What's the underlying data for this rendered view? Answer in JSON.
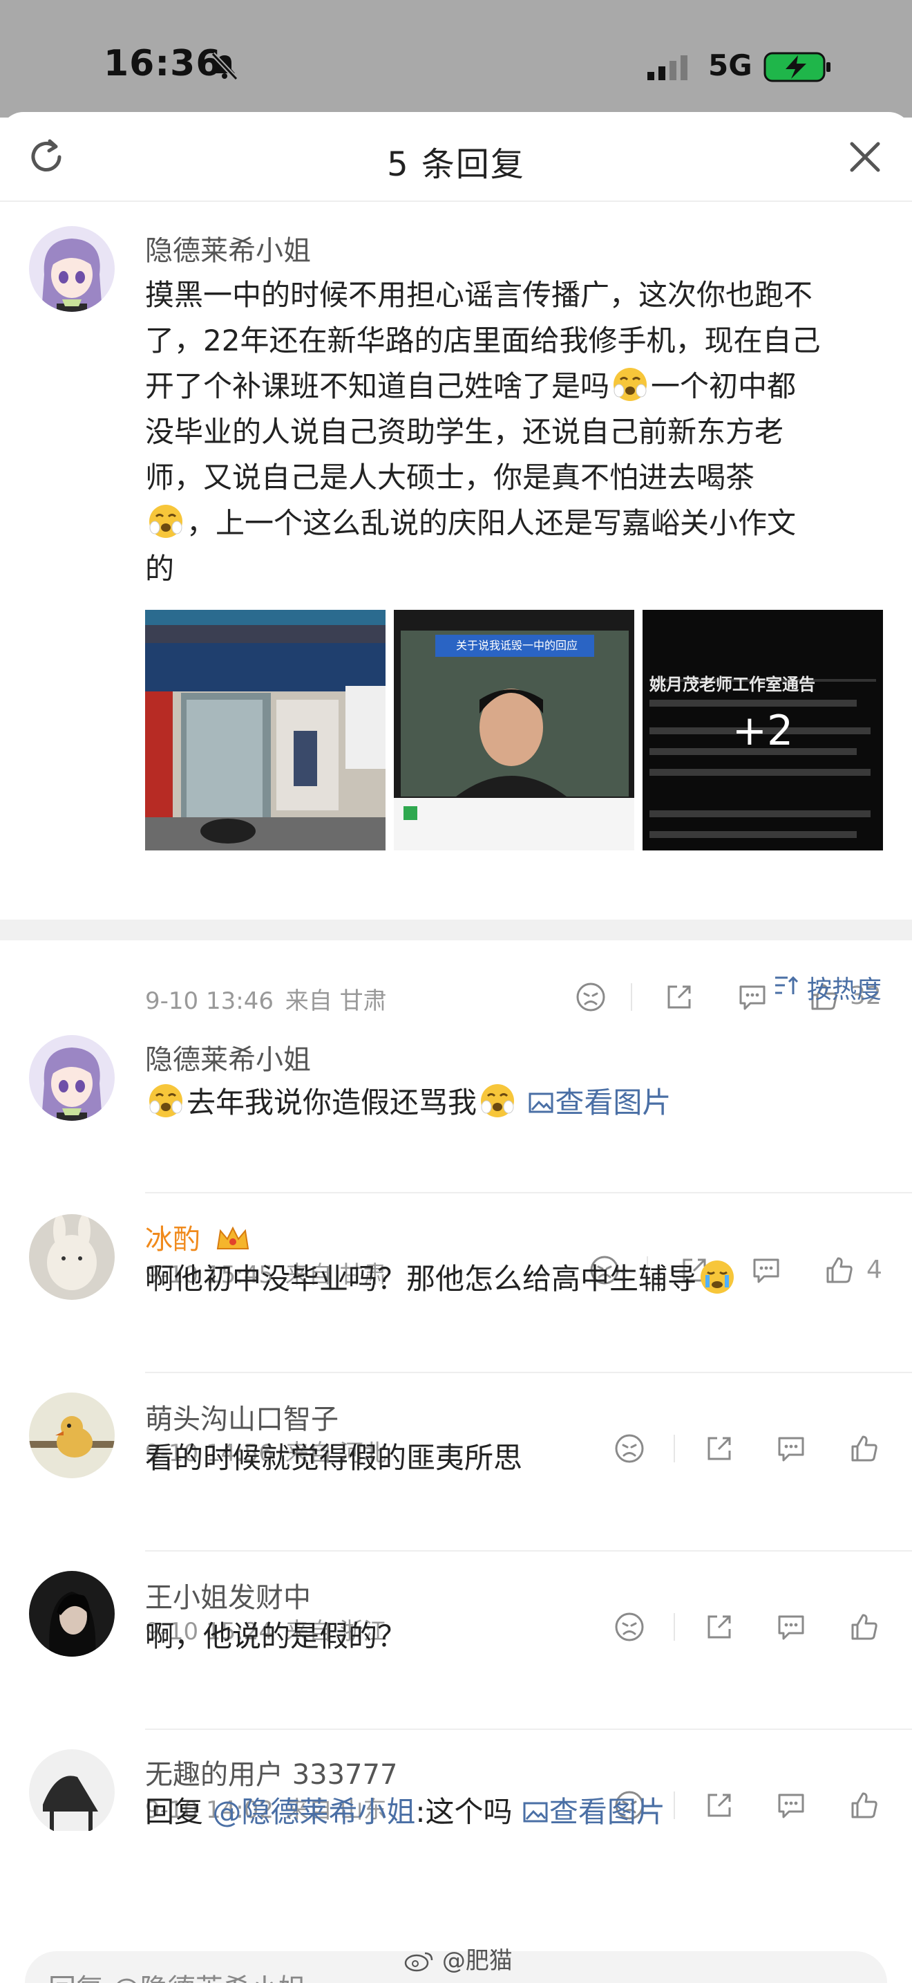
{
  "status": {
    "time": "16:36",
    "network": "5G"
  },
  "sheet": {
    "title": "5 条回复"
  },
  "main_comment": {
    "user": "隐德莱希小姐",
    "text_lines": [
      "摸黑一中的时候不用担心谣言传播广，这次你也跑不",
      "了，22年还在新华路的店里面给我修手机，现在自己",
      "开了个补课班不知道自己姓啥了是吗",
      "一个初中都",
      "没毕业的人说自己资助学生，还说自己前新东方老",
      "师，又说自己是人大硕士，你是真不怕进去喝茶",
      "，上一个这么乱说的庆阳人还是写嘉峪关小作文",
      "的"
    ],
    "image2_title": "关于说我诋毁一中的回应",
    "image3_title": "姚月茂老师工作室通告",
    "image3_more": "+2",
    "time": "9-10 13:46",
    "source": "来自 甘肃",
    "likes": "32"
  },
  "sort": {
    "label": "按热度"
  },
  "replies": [
    {
      "user": "隐德莱希小姐",
      "text_a": "去年我说你造假还骂我",
      "view_image": "查看图片",
      "time": "9-10 15:45",
      "source": "来自 甘肃",
      "likes": "4"
    },
    {
      "user": "冰酌",
      "text": "啊他初中没毕业吗？那他怎么给高中生辅导",
      "time": "9-10 14:56",
      "source": "来自 河北"
    },
    {
      "user": "萌头沟山口智子",
      "text": "看的时候就觉得假的匪夷所思",
      "time": "9-10 15:24",
      "source": "来自 浙江"
    },
    {
      "user": "王小姐发财中",
      "text": "啊，他说的是假的？",
      "time": "9-10 14:02",
      "source": "来自 山东"
    },
    {
      "user": "无趣的用户 333777",
      "reply_prefix": "回复",
      "mention": "@隐德莱希小姐",
      "text": ":这个吗",
      "view_image": "查看图片"
    }
  ],
  "reply_bar": {
    "placeholder": "回复 @隐德莱希小姐"
  },
  "watermark": "@肥猫"
}
